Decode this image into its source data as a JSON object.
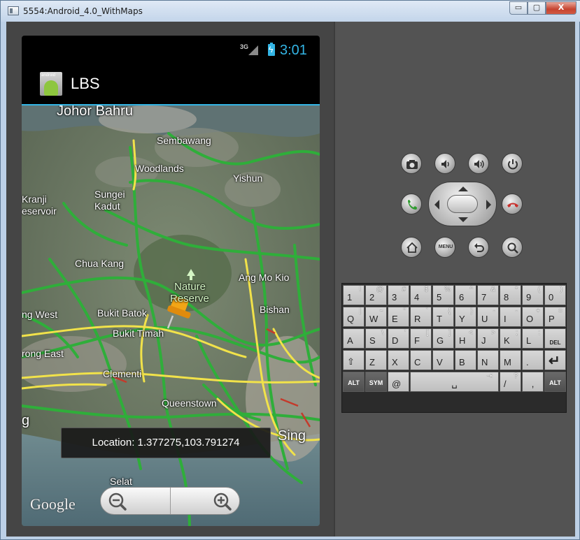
{
  "window": {
    "title": "5554:Android_4.0_WithMaps",
    "minimize": "▭",
    "maximize": "▢",
    "close": "X"
  },
  "status_bar": {
    "network": "3G",
    "time": "3:01"
  },
  "action_bar": {
    "app_title": "LBS",
    "app_icon_text": "android"
  },
  "map": {
    "labels": {
      "johor_bahru": "Johor Bahru",
      "sembawang": "Sembawang",
      "woodlands": "Woodlands",
      "yishun": "Yishun",
      "kranji": "Kranji",
      "reservoir": "eservoir",
      "sungei": "Sungei",
      "kadut": "Kadut",
      "choa_chu_kang": "Chua Kang",
      "ang_mo_kio": "Ang Mo Kio",
      "nature": "Nature",
      "reserve": "Reserve",
      "bukit_batok": "Bukit Batok",
      "bukit_timah": "Bukit Timah",
      "bishan": "Bishan",
      "jurong_west": "ng West",
      "jurong_east": "rong East",
      "clementi": "Clementi",
      "queenstown": "Queenstown",
      "singapore": "Sing",
      "selat": "Selat",
      "left_g": "g"
    },
    "toast": "Location: 1.377275,103.791274",
    "attribution": "Google",
    "zoom_out": "zoom-out",
    "zoom_in": "zoom-in"
  },
  "controls": {
    "camera": "camera-icon",
    "volume_down": "volume-down-icon",
    "volume_up": "volume-up-icon",
    "power": "power-icon",
    "call": "call-icon",
    "end_call": "end-call-icon",
    "home": "home-icon",
    "menu": "MENU",
    "back": "back-icon",
    "search": "search-icon"
  },
  "keyboard": {
    "row1": [
      {
        "main": "1",
        "alt": "!"
      },
      {
        "main": "2",
        "alt": "@"
      },
      {
        "main": "3",
        "alt": "#"
      },
      {
        "main": "4",
        "alt": "$"
      },
      {
        "main": "5",
        "alt": "%"
      },
      {
        "main": "6",
        "alt": "^"
      },
      {
        "main": "7",
        "alt": "&"
      },
      {
        "main": "8",
        "alt": "*"
      },
      {
        "main": "9",
        "alt": "("
      },
      {
        "main": "0",
        "alt": ")"
      }
    ],
    "row2": [
      {
        "main": "Q",
        "alt": "|"
      },
      {
        "main": "W",
        "alt": "~"
      },
      {
        "main": "E",
        "alt": "\""
      },
      {
        "main": "R",
        "alt": "`"
      },
      {
        "main": "T",
        "alt": "{"
      },
      {
        "main": "Y",
        "alt": "}"
      },
      {
        "main": "U",
        "alt": "-"
      },
      {
        "main": "I",
        "alt": "-"
      },
      {
        "main": "O",
        "alt": "+"
      },
      {
        "main": "P",
        "alt": "="
      }
    ],
    "row3": [
      {
        "main": "A",
        "alt": ""
      },
      {
        "main": "S",
        "alt": "\\"
      },
      {
        "main": "D",
        "alt": "'"
      },
      {
        "main": "F",
        "alt": "["
      },
      {
        "main": "G",
        "alt": "]"
      },
      {
        "main": "H",
        "alt": "<"
      },
      {
        "main": "J",
        "alt": ">"
      },
      {
        "main": "K",
        "alt": ";"
      },
      {
        "main": "L",
        "alt": ":"
      },
      {
        "main": "DEL",
        "alt": ""
      }
    ],
    "row4": [
      {
        "main": "⇧",
        "alt": ""
      },
      {
        "main": "Z",
        "alt": ""
      },
      {
        "main": "X",
        "alt": ""
      },
      {
        "main": "C",
        "alt": ""
      },
      {
        "main": "V",
        "alt": ""
      },
      {
        "main": "B",
        "alt": ""
      },
      {
        "main": "N",
        "alt": ""
      },
      {
        "main": "M",
        "alt": ""
      },
      {
        "main": ".",
        "alt": ""
      },
      {
        "main": "↵",
        "alt": ""
      }
    ],
    "row5": {
      "alt_left": "ALT",
      "sym": "SYM",
      "at": "@",
      "space": "␣",
      "tab": "⇥",
      "slash": "/",
      "question": "?",
      "comma": ",",
      "alt_right": "ALT"
    }
  },
  "colors": {
    "holo_blue": "#33b5e5",
    "road_green": "#2fae3a",
    "road_yellow": "#f1e24a",
    "road_red": "#c43a2b"
  }
}
